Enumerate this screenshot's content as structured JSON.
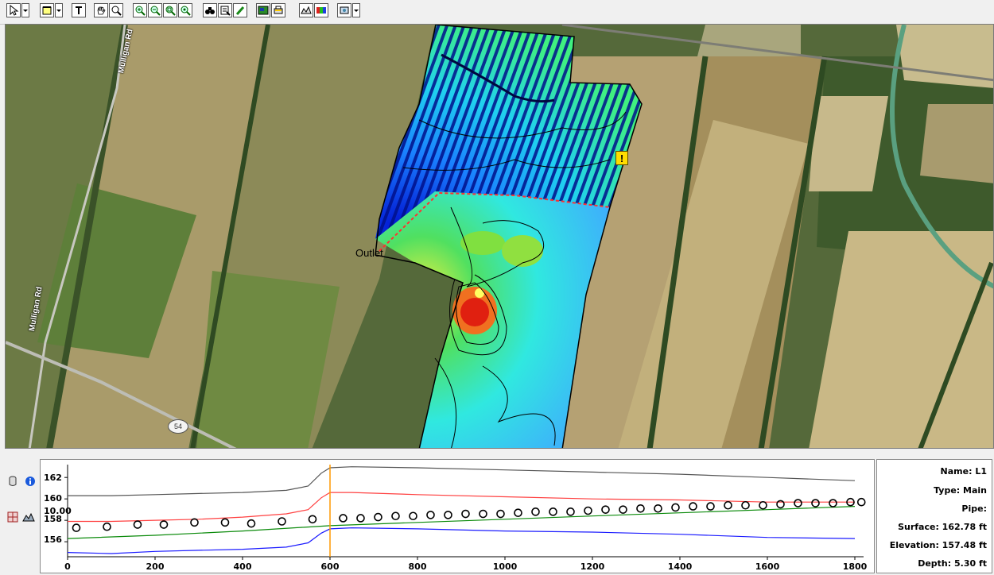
{
  "toolbar": {
    "groups": [
      {
        "tools": [
          "select-arrow-icon",
          "dropdown-arrow-icon"
        ]
      },
      {
        "tools": [
          "boundary-tool-icon",
          "dropdown-arrow-icon"
        ]
      },
      {
        "tools": [
          "text-tool-icon"
        ]
      },
      {
        "tools": [
          "pan-hand-icon",
          "zoom-tool-icon"
        ]
      },
      {
        "tools": [
          "zoom-in-icon",
          "zoom-out-icon",
          "zoom-window-icon",
          "zoom-extents-icon"
        ]
      },
      {
        "tools": [
          "find-binoculars-icon",
          "properties-icon",
          "pencil-edit-icon"
        ]
      },
      {
        "tools": [
          "map-layer-icon",
          "print-icon"
        ]
      },
      {
        "tools": [
          "contours-icon",
          "color-legend-icon"
        ]
      },
      {
        "tools": [
          "settings-dropdown-icon",
          "dropdown-arrow-icon"
        ]
      }
    ]
  },
  "map": {
    "road_labels": [
      "Mulligan Rd",
      "Mulligan Rd"
    ],
    "highway_shield": "54",
    "outlet_label": "Outlet",
    "warning_marker": "!"
  },
  "profile": {
    "y_ticks": [
      "162",
      "160",
      "158",
      "156"
    ],
    "x_ticks": [
      "0",
      "200",
      "400",
      "600",
      "800",
      "1000",
      "1200",
      "1400",
      "1600",
      "1800"
    ],
    "marker_value": "10.00",
    "cursor_x": 600,
    "x_range": [
      0,
      1820
    ],
    "y_range": [
      154.6,
      163.2
    ],
    "series": {
      "surface": {
        "color": "#555555",
        "points": [
          [
            0,
            160.3
          ],
          [
            100,
            160.3
          ],
          [
            200,
            160.4
          ],
          [
            300,
            160.5
          ],
          [
            400,
            160.6
          ],
          [
            500,
            160.8
          ],
          [
            550,
            161.2
          ],
          [
            580,
            162.4
          ],
          [
            600,
            162.9
          ],
          [
            650,
            163.0
          ],
          [
            800,
            162.9
          ],
          [
            1000,
            162.7
          ],
          [
            1200,
            162.5
          ],
          [
            1400,
            162.3
          ],
          [
            1600,
            162.0
          ],
          [
            1800,
            161.7
          ]
        ]
      },
      "red": {
        "color": "#ff4040",
        "points": [
          [
            0,
            157.9
          ],
          [
            100,
            157.9
          ],
          [
            200,
            158.0
          ],
          [
            300,
            158.1
          ],
          [
            400,
            158.3
          ],
          [
            500,
            158.6
          ],
          [
            550,
            159.0
          ],
          [
            580,
            160.1
          ],
          [
            600,
            160.6
          ],
          [
            650,
            160.6
          ],
          [
            800,
            160.4
          ],
          [
            1000,
            160.2
          ],
          [
            1200,
            160.0
          ],
          [
            1400,
            159.9
          ],
          [
            1600,
            159.7
          ],
          [
            1800,
            159.7
          ]
        ]
      },
      "green": {
        "color": "#0a8a0a",
        "points": [
          [
            0,
            156.3
          ],
          [
            200,
            156.6
          ],
          [
            400,
            157.0
          ],
          [
            600,
            157.5
          ],
          [
            800,
            157.8
          ],
          [
            1000,
            158.1
          ],
          [
            1200,
            158.4
          ],
          [
            1400,
            158.7
          ],
          [
            1600,
            159.0
          ],
          [
            1800,
            159.3
          ]
        ]
      },
      "blue": {
        "color": "#1a1aff",
        "points": [
          [
            0,
            155.0
          ],
          [
            100,
            154.9
          ],
          [
            200,
            155.1
          ],
          [
            300,
            155.2
          ],
          [
            400,
            155.3
          ],
          [
            500,
            155.5
          ],
          [
            550,
            155.9
          ],
          [
            580,
            156.8
          ],
          [
            600,
            157.2
          ],
          [
            650,
            157.3
          ],
          [
            800,
            157.2
          ],
          [
            1000,
            157.0
          ],
          [
            1200,
            156.9
          ],
          [
            1400,
            156.7
          ],
          [
            1600,
            156.4
          ],
          [
            1800,
            156.3
          ]
        ]
      }
    },
    "circles": [
      [
        20,
        157.3
      ],
      [
        90,
        157.4
      ],
      [
        160,
        157.6
      ],
      [
        220,
        157.6
      ],
      [
        290,
        157.8
      ],
      [
        360,
        157.8
      ],
      [
        420,
        157.7
      ],
      [
        490,
        157.9
      ],
      [
        560,
        158.1
      ],
      [
        630,
        158.2
      ],
      [
        670,
        158.2
      ],
      [
        710,
        158.3
      ],
      [
        750,
        158.4
      ],
      [
        790,
        158.4
      ],
      [
        830,
        158.5
      ],
      [
        870,
        158.5
      ],
      [
        910,
        158.6
      ],
      [
        950,
        158.6
      ],
      [
        990,
        158.6
      ],
      [
        1030,
        158.7
      ],
      [
        1070,
        158.8
      ],
      [
        1110,
        158.8
      ],
      [
        1150,
        158.8
      ],
      [
        1190,
        158.9
      ],
      [
        1230,
        159.0
      ],
      [
        1270,
        159.0
      ],
      [
        1310,
        159.1
      ],
      [
        1350,
        159.1
      ],
      [
        1390,
        159.2
      ],
      [
        1430,
        159.3
      ],
      [
        1470,
        159.3
      ],
      [
        1510,
        159.4
      ],
      [
        1550,
        159.4
      ],
      [
        1590,
        159.4
      ],
      [
        1630,
        159.5
      ],
      [
        1670,
        159.6
      ],
      [
        1710,
        159.6
      ],
      [
        1750,
        159.6
      ],
      [
        1790,
        159.7
      ],
      [
        1815,
        159.7
      ]
    ]
  },
  "info": {
    "name": "Name: L1",
    "type": "Type: Main",
    "pipe": "Pipe:",
    "surface": "Surface: 162.78 ft",
    "elevation": "Elevation: 157.48 ft",
    "depth": "Depth: 5.30 ft"
  },
  "left_tools": [
    "database-icon",
    "info-icon",
    "layers-icon",
    "profile-chart-icon"
  ]
}
